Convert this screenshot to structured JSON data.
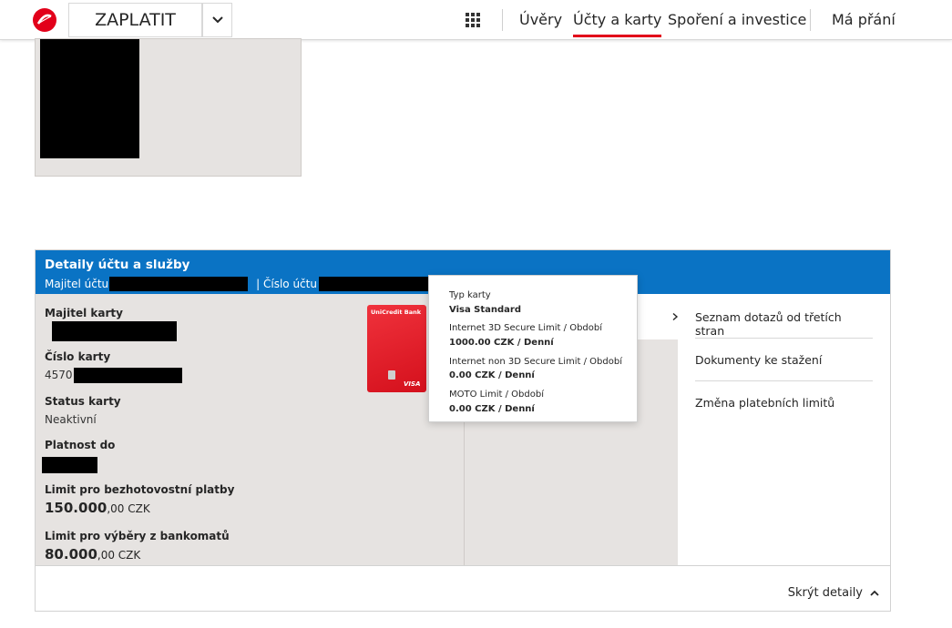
{
  "topnav": {
    "pay_label": "ZAPLATIT",
    "items": [
      {
        "label": "Úvěry"
      },
      {
        "label": "Účty a karty"
      },
      {
        "label": "Spoření a investice"
      },
      {
        "label": "Má přání"
      }
    ],
    "active_item": "Účty a karty",
    "accent_color": "#e2001a"
  },
  "panel": {
    "title": "Detaily účtu a služby",
    "owner_label": "Majitel účtu",
    "account_label": "| Číslo účtu",
    "header_color": "#0a73c4",
    "fields": {
      "card_holder_label": "Majitel karty",
      "card_number_label": "Číslo karty",
      "card_number_prefix": "4570",
      "status_label": "Status karty",
      "status_value": "Neaktivní",
      "validity_label": "Platnost do",
      "cashless_label": "Limit pro bezhotovostní platby",
      "cashless_int": "150.000",
      "cashless_dec": ",00 CZK",
      "atm_label": "Limit pro výběry z bankomatů",
      "atm_int": "80.000",
      "atm_dec": ",00 CZK"
    },
    "card_image": {
      "brand": "UniCredit Bank",
      "network": "VISA"
    },
    "menu": [
      {
        "label": "Seznam dotazů od třetích stran"
      },
      {
        "label": "Dokumenty ke stažení"
      },
      {
        "label": "Změna platebních limitů"
      }
    ],
    "hide_details": "Skrýt detaily"
  },
  "tooltip": {
    "card_type_label": "Typ karty",
    "card_type_value": "Visa Standard",
    "limit_3ds_label": "Internet 3D Secure Limit / Období",
    "limit_3ds_value": "1000.00 CZK / Denní",
    "limit_non3ds_label": "Internet non 3D Secure Limit / Období",
    "limit_non3ds_value": "0.00 CZK / Denní",
    "moto_label": "MOTO Limit / Období",
    "moto_value": "0.00 CZK / Denní"
  },
  "icons": [
    "unicredit-logo-icon",
    "chevron-down-icon",
    "apps-grid-icon",
    "chevron-right-icon",
    "chevron-up-icon"
  ]
}
